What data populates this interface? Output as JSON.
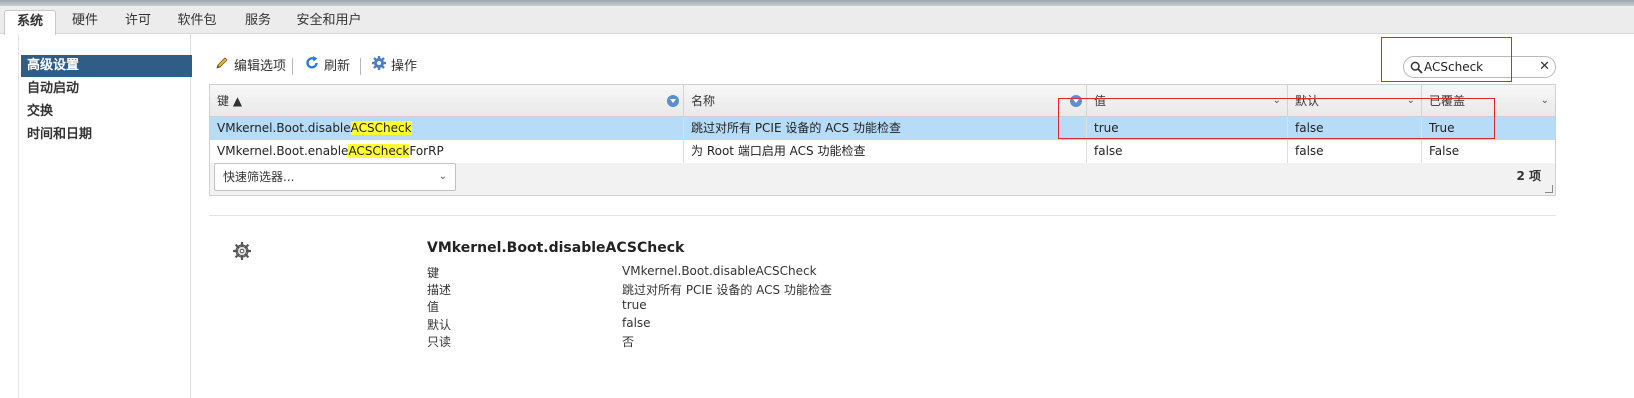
{
  "tabs": [
    "系统",
    "硬件",
    "许可",
    "软件包",
    "服务",
    "安全和用户"
  ],
  "nav": [
    "高级设置",
    "自动启动",
    "交换",
    "时间和日期"
  ],
  "toolbar": {
    "edit": "编辑选项",
    "refresh": "刷新",
    "actions": "操作"
  },
  "search": {
    "value": "ACScheck"
  },
  "columns": {
    "key": "键 ▲",
    "name": "名称",
    "value": "值",
    "default": "默认",
    "overridden": "已覆盖"
  },
  "rows": [
    {
      "key_prefix": "VMkernel.Boot.disable",
      "key_match": "ACSCheck",
      "key_suffix": "",
      "name": "跳过对所有 PCIE 设备的 ACS 功能检查",
      "value": "true",
      "default": "false",
      "overridden": "True"
    },
    {
      "key_prefix": "VMkernel.Boot.enable",
      "key_match": "ACSCheck",
      "key_suffix": "ForRP",
      "name": "为 Root 端口启用 ACS 功能检查",
      "value": "false",
      "default": "false",
      "overridden": "False"
    }
  ],
  "quick_filter": "快速筛选器...",
  "count": "2 项",
  "detail": {
    "title": "VMkernel.Boot.disableACSCheck",
    "fields": [
      {
        "label": "键",
        "value": "VMkernel.Boot.disableACSCheck"
      },
      {
        "label": "描述",
        "value": "跳过对所有 PCIE 设备的 ACS 功能检查"
      },
      {
        "label": "值",
        "value": "true"
      },
      {
        "label": "默认",
        "value": "false"
      },
      {
        "label": "只读",
        "value": "否"
      }
    ]
  },
  "colors": {
    "accent": "#2f5d86",
    "selected_row": "#b6dcf7",
    "highlight": "#ffff33",
    "annotation": "#e0262b"
  },
  "icons": [
    "pencil-icon",
    "refresh-icon",
    "gear-icon",
    "search-icon",
    "clear-icon",
    "chevron-down-icon",
    "filter-icon",
    "resize-grip-icon"
  ]
}
